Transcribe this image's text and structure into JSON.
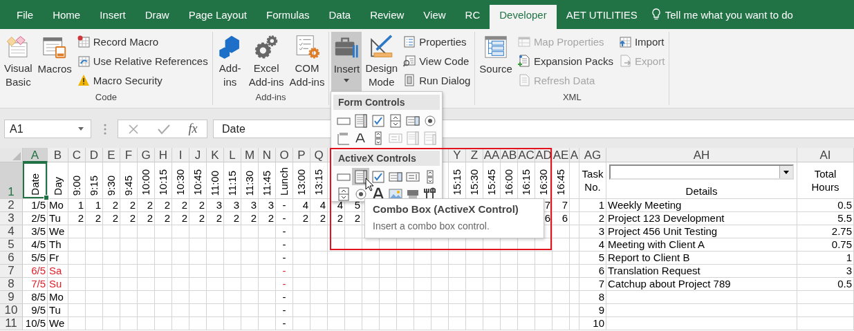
{
  "tabs": [
    {
      "label": "File",
      "selected": false
    },
    {
      "label": "Home",
      "selected": false
    },
    {
      "label": "Insert",
      "selected": false
    },
    {
      "label": "Draw",
      "selected": false
    },
    {
      "label": "Page Layout",
      "selected": false
    },
    {
      "label": "Formulas",
      "selected": false
    },
    {
      "label": "Data",
      "selected": false
    },
    {
      "label": "Review",
      "selected": false
    },
    {
      "label": "View",
      "selected": false
    },
    {
      "label": "RC",
      "selected": false
    },
    {
      "label": "Developer",
      "selected": true
    },
    {
      "label": "AET UTILITIES",
      "selected": false
    }
  ],
  "tell_me": {
    "placeholder": "Tell me what you want to do"
  },
  "ribbon": {
    "groups": [
      {
        "label": "Code",
        "items": [
          {
            "kind": "large",
            "label": "Visual\nBasic"
          },
          {
            "kind": "large",
            "label": "Macros"
          },
          {
            "kind": "stack",
            "buttons": [
              {
                "label": "Record Macro",
                "disabled": false
              },
              {
                "label": "Use Relative References",
                "disabled": false
              },
              {
                "label": "Macro Security",
                "disabled": false
              }
            ]
          }
        ]
      },
      {
        "label": "Add-ins",
        "items": [
          {
            "kind": "large",
            "label": "Add-\nins"
          },
          {
            "kind": "large",
            "label": "Excel\nAdd-ins"
          },
          {
            "kind": "large",
            "label": "COM\nAdd-ins"
          }
        ]
      },
      {
        "items": [
          {
            "kind": "menu",
            "label": "Insert",
            "expanded": true
          },
          {
            "kind": "large",
            "label": "Design\nMode"
          },
          {
            "kind": "stack",
            "buttons": [
              {
                "label": "Properties",
                "disabled": false
              },
              {
                "label": "View Code",
                "disabled": false
              },
              {
                "label": "Run Dialog",
                "disabled": false
              }
            ]
          }
        ]
      },
      {
        "label": "XML",
        "items": [
          {
            "kind": "large",
            "label": "Source"
          },
          {
            "kind": "stack",
            "buttons": [
              {
                "label": "Map Properties",
                "disabled": true
              },
              {
                "label": "Expansion Packs",
                "disabled": false
              },
              {
                "label": "Refresh Data",
                "disabled": true
              }
            ]
          },
          {
            "kind": "stack",
            "buttons": [
              {
                "label": "Import",
                "disabled": false
              },
              {
                "label": "Export",
                "disabled": true
              }
            ]
          }
        ]
      }
    ]
  },
  "formula_bar": {
    "name_box": "A1",
    "function_button": "fx",
    "formula": "Date"
  },
  "sheet": {
    "columns": [
      {
        "label": "A",
        "selected": true
      },
      {
        "label": "B",
        "selected": false
      },
      {
        "label": "C",
        "selected": false
      },
      {
        "label": "D",
        "selected": false
      },
      {
        "label": "E",
        "selected": false
      },
      {
        "label": "F",
        "selected": false
      },
      {
        "label": "G",
        "selected": false
      },
      {
        "label": "H",
        "selected": false
      },
      {
        "label": "I",
        "selected": false
      },
      {
        "label": "J",
        "selected": false
      },
      {
        "label": "K",
        "selected": false
      },
      {
        "label": "L",
        "selected": false
      },
      {
        "label": "M",
        "selected": false
      },
      {
        "label": "N",
        "selected": false
      },
      {
        "label": "O",
        "selected": false
      },
      {
        "label": "P",
        "selected": false
      },
      {
        "label": "Q",
        "selected": false
      },
      {
        "selected": false
      },
      {},
      {},
      {},
      {},
      {},
      {
        "selected": false
      },
      {
        "label": "Y",
        "selected": false
      },
      {
        "label": "Z",
        "selected": false
      },
      {
        "label": "AA",
        "selected": false
      },
      {
        "label": "AB",
        "selected": false
      },
      {
        "label": "AC",
        "selected": false
      },
      {
        "label": "AD",
        "selected": false
      },
      {
        "label": "AE",
        "selected": false
      },
      {
        "label": "A",
        "selected": false
      },
      {
        "label": "AG",
        "selected": false
      },
      {
        "label": "AH",
        "selected": false
      },
      {
        "label": "AI",
        "selected": false
      }
    ],
    "header_row": {
      "number": "1",
      "selected": true,
      "cells": [
        {
          "kind": "vertical",
          "text": "Date"
        },
        {
          "kind": "vertical",
          "text": "Day"
        },
        {
          "kind": "vertical",
          "text": "9:00"
        },
        {
          "kind": "vertical",
          "text": "9:15"
        },
        {
          "kind": "vertical",
          "text": "9:30"
        },
        {
          "kind": "vertical",
          "text": "9:45"
        },
        {
          "kind": "vertical",
          "text": "10:00"
        },
        {
          "kind": "vertical",
          "text": "10:15"
        },
        {
          "kind": "vertical",
          "text": "10:30"
        },
        {
          "kind": "vertical",
          "text": "10:45"
        },
        {
          "kind": "vertical",
          "text": "11:00"
        },
        {
          "kind": "vertical",
          "text": "11:15"
        },
        {
          "kind": "vertical",
          "text": "11:30"
        },
        {
          "kind": "vertical",
          "text": "11:45"
        },
        {
          "kind": "vertical",
          "text": "Lunch"
        },
        {
          "kind": "vertical",
          "text": "13:00"
        },
        {
          "kind": "vertical",
          "text": "13:15"
        },
        null,
        null,
        null,
        null,
        null,
        null,
        null,
        {
          "kind": "vertical",
          "text": "15:15"
        },
        {
          "kind": "vertical",
          "text": "15:30"
        },
        {
          "kind": "vertical",
          "text": "15:45"
        },
        {
          "kind": "vertical",
          "text": "16:00"
        },
        {
          "kind": "vertical",
          "text": "16:15"
        },
        {
          "kind": "vertical",
          "text": "16:30"
        },
        {
          "kind": "vertical",
          "text": "16:45"
        },
        null,
        {
          "kind": "text",
          "text": "Task\nNo."
        },
        {
          "kind": "combo",
          "text": "Details"
        },
        {
          "kind": "text",
          "text": "Total\nHours"
        }
      ]
    },
    "rows": [
      {
        "number": "2",
        "selected": false,
        "weekend": false,
        "cells": [
          "1/5",
          "Mo",
          "1",
          "1",
          "2",
          "2",
          "2",
          "2",
          "2",
          "2",
          "3",
          "3",
          "3",
          "3",
          "-",
          "4",
          "4",
          "4",
          "5",
          null,
          null,
          null,
          null,
          null,
          null,
          null,
          null,
          null,
          null,
          "7",
          "7",
          null,
          "1",
          "Weekly Meeting",
          "0.5"
        ]
      },
      {
        "number": "3",
        "selected": false,
        "weekend": false,
        "cells": [
          "2/5",
          "Tu",
          "2",
          "2",
          "2",
          "2",
          "2",
          "2",
          "2",
          "2",
          "2",
          "2",
          "2",
          "2",
          "-",
          "2",
          "2",
          "2",
          "2",
          null,
          null,
          null,
          null,
          null,
          null,
          null,
          null,
          null,
          null,
          "6",
          "6",
          null,
          "2",
          "Project 123 Development",
          "5.5"
        ]
      },
      {
        "number": "4",
        "selected": false,
        "weekend": false,
        "cells": [
          "3/5",
          "We",
          null,
          null,
          null,
          null,
          null,
          null,
          null,
          null,
          null,
          null,
          null,
          null,
          "-",
          null,
          null,
          null,
          null,
          null,
          null,
          null,
          null,
          null,
          null,
          null,
          null,
          null,
          null,
          null,
          null,
          null,
          "3",
          "Project 456 Unit Testing",
          "2.75"
        ]
      },
      {
        "number": "5",
        "selected": false,
        "weekend": false,
        "cells": [
          "4/5",
          "Th",
          null,
          null,
          null,
          null,
          null,
          null,
          null,
          null,
          null,
          null,
          null,
          null,
          "-",
          null,
          null,
          null,
          null,
          null,
          null,
          null,
          null,
          null,
          null,
          null,
          null,
          null,
          null,
          null,
          null,
          null,
          "4",
          "Meeting with Client A",
          "0.75"
        ]
      },
      {
        "number": "6",
        "selected": false,
        "weekend": false,
        "cells": [
          "5/5",
          "Fr",
          null,
          null,
          null,
          null,
          null,
          null,
          null,
          null,
          null,
          null,
          null,
          null,
          "-",
          null,
          null,
          null,
          null,
          null,
          null,
          null,
          null,
          null,
          null,
          null,
          null,
          null,
          null,
          null,
          null,
          null,
          "5",
          "Report to Client B",
          "1"
        ]
      },
      {
        "number": "7",
        "selected": false,
        "weekend": true,
        "cells": [
          "6/5",
          "Sa",
          null,
          null,
          null,
          null,
          null,
          null,
          null,
          null,
          null,
          null,
          null,
          null,
          "-",
          null,
          null,
          null,
          null,
          null,
          null,
          null,
          null,
          null,
          null,
          null,
          null,
          null,
          null,
          null,
          null,
          null,
          "6",
          "Translation Request",
          "3"
        ]
      },
      {
        "number": "8",
        "selected": false,
        "weekend": true,
        "cells": [
          "7/5",
          "Su",
          null,
          null,
          null,
          null,
          null,
          null,
          null,
          null,
          null,
          null,
          null,
          null,
          "-",
          null,
          null,
          null,
          null,
          null,
          null,
          null,
          null,
          null,
          null,
          null,
          null,
          null,
          null,
          null,
          null,
          null,
          "7",
          "Catchup about Project 789",
          "0.5"
        ]
      },
      {
        "number": "9",
        "selected": false,
        "weekend": false,
        "cells": [
          "8/5",
          "Mo",
          null,
          null,
          null,
          null,
          null,
          null,
          null,
          null,
          null,
          null,
          null,
          null,
          "-",
          null,
          null,
          null,
          null,
          null,
          null,
          null,
          null,
          null,
          null,
          null,
          null,
          null,
          null,
          null,
          null,
          null,
          "8",
          null,
          null
        ]
      },
      {
        "number": "10",
        "selected": false,
        "weekend": false,
        "cells": [
          "9/5",
          "Tu",
          null,
          null,
          null,
          null,
          null,
          null,
          null,
          null,
          null,
          null,
          null,
          null,
          "-",
          null,
          null,
          null,
          null,
          null,
          null,
          null,
          null,
          null,
          null,
          null,
          null,
          null,
          null,
          null,
          null,
          null,
          "9",
          null,
          null
        ]
      },
      {
        "number": "11",
        "selected": false,
        "weekend": false,
        "cells": [
          "10/5",
          "We",
          null,
          null,
          null,
          null,
          null,
          null,
          null,
          null,
          null,
          null,
          null,
          null,
          "-",
          null,
          null,
          null,
          null,
          null,
          null,
          null,
          null,
          null,
          null,
          null,
          null,
          null,
          null,
          null,
          null,
          null,
          "10",
          null,
          null
        ]
      }
    ]
  },
  "insert_menu": {
    "sections": [
      {
        "title": "Form Controls",
        "controls": [
          {
            "selected": false,
            "disabled": false
          },
          {
            "selected": false,
            "disabled": false
          },
          {
            "selected": false,
            "disabled": false
          },
          {
            "selected": false,
            "disabled": false
          },
          {
            "selected": false,
            "disabled": false
          },
          {
            "selected": false,
            "disabled": false
          },
          {
            "selected": false,
            "disabled": false
          },
          {
            "selected": false,
            "disabled": false
          },
          {
            "selected": false,
            "disabled": false
          },
          {
            "selected": false,
            "disabled": true
          },
          {
            "selected": false,
            "disabled": true
          },
          {
            "selected": false,
            "disabled": true
          }
        ]
      },
      {
        "title": "ActiveX Controls",
        "controls": [
          {
            "selected": false,
            "disabled": false
          },
          {
            "selected": true,
            "disabled": false
          },
          {
            "selected": false,
            "disabled": false
          },
          {
            "selected": false,
            "disabled": false
          },
          {
            "selected": false,
            "disabled": false
          },
          {
            "selected": false,
            "disabled": false
          },
          {
            "selected": false,
            "disabled": false
          },
          {
            "selected": false,
            "disabled": false
          },
          {
            "selected": false,
            "disabled": false
          },
          {
            "selected": false,
            "disabled": false
          },
          {
            "selected": false,
            "disabled": false
          },
          {
            "selected": false,
            "disabled": false
          }
        ]
      }
    ]
  },
  "tooltip": {
    "title": "Combo Box (ActiveX Control)",
    "description": "Insert a combo box control."
  },
  "highlight_frame": true,
  "mouse_pointer": true
}
